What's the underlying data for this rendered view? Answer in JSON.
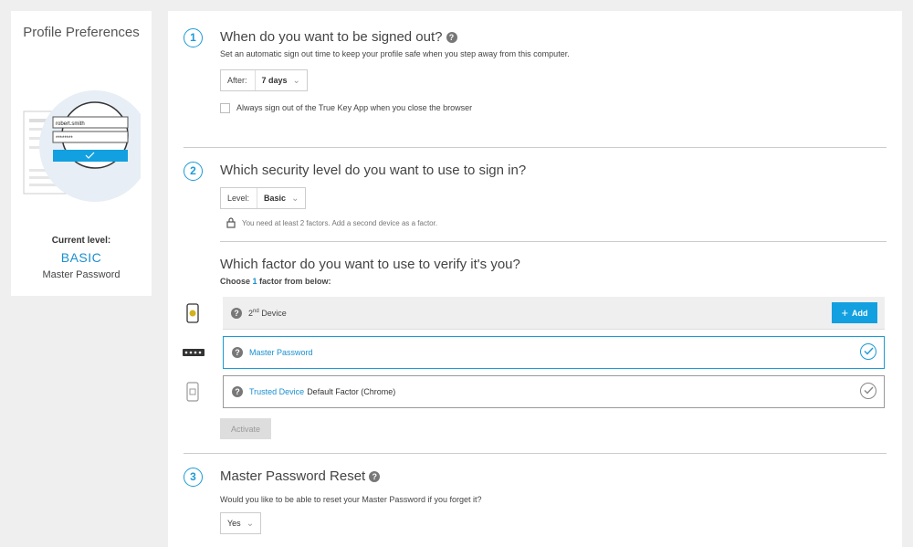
{
  "sidebar": {
    "title": "Profile Preferences",
    "illustration": {
      "username": "robert.smith",
      "password": "********"
    },
    "current_label": "Current level:",
    "current_level": "BASIC",
    "current_factor": "Master Password"
  },
  "section1": {
    "number": "1",
    "title": "When do you want to be signed out?",
    "description": "Set an automatic sign out time to keep your profile safe when you step away from this computer.",
    "select_label": "After:",
    "select_value": "7 days",
    "checkbox_label": "Always sign out of the True Key App when you close the browser",
    "checkbox_checked": false
  },
  "section2": {
    "number": "2",
    "title": "Which security level do you want to use to sign in?",
    "select_label": "Level:",
    "select_value": "Basic",
    "notice": "You need at least 2 factors. Add a second device as a factor.",
    "factor_title": "Which factor do you want to use to verify it's you?",
    "choose_prefix": "Choose ",
    "choose_count": "1",
    "choose_suffix": " factor from below:",
    "factors": [
      {
        "label_base": "2",
        "label_sup": "nd",
        "label_rest": " Device",
        "action": "Add",
        "icon": "phone-icon"
      },
      {
        "label": "Master Password",
        "selected": true,
        "icon": "password-dots-icon"
      },
      {
        "label": "Trusted Device",
        "extra": "Default Factor (Chrome)",
        "selected": false,
        "icon": "trusted-device-icon"
      }
    ],
    "activate_label": "Activate"
  },
  "section3": {
    "number": "3",
    "title": "Master Password Reset",
    "description": "Would you like to be able to reset your Master Password if you forget it?",
    "select_value": "Yes"
  },
  "help_glyph": "?",
  "colors": {
    "accent": "#1a9bd7",
    "button_blue": "#12a0e0",
    "background": "#efefef"
  }
}
